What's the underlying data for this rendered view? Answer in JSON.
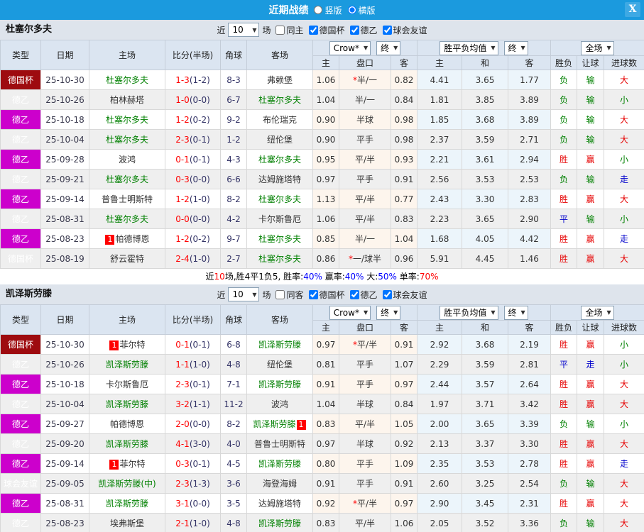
{
  "titlebar": {
    "title": "近期战绩",
    "radio_options": [
      {
        "label": "竖版",
        "selected": false
      },
      {
        "label": "横版",
        "selected": true
      }
    ],
    "close_label": "X"
  },
  "columns": {
    "type": "类型",
    "date": "日期",
    "home": "主场",
    "score": "比分(半场)",
    "corner": "角球",
    "away": "客场",
    "odds_home": "主",
    "handicap": "盘口",
    "odds_away": "客",
    "avg_home": "主",
    "avg_draw": "和",
    "avg_away": "客",
    "wdl": "胜负",
    "ah_result": "让球",
    "goals": "进球数",
    "dd_crow": "Crow*",
    "dd_final1": "终",
    "dd_avg": "胜平负均值",
    "dd_final2": "终",
    "dd_full": "全场"
  },
  "row_columns": [
    "type",
    "date",
    "home",
    "score_ft_ht",
    "corners",
    "away",
    "crow_home",
    "crow_handicap",
    "crow_away",
    "avg_home",
    "avg_draw",
    "avg_away",
    "result_wdl",
    "result_handicap",
    "result_goals"
  ],
  "colors": {
    "titlebar": "#1b9ade",
    "cup_bg": "#9e0b0f",
    "league_bg": "#cc00cc",
    "friendly_bg": "#00b3ad",
    "focal_team": "#008000",
    "win_red": "#e60000",
    "loss_green": "#008000",
    "draw_blue": "#0000cc",
    "score_red": "#ff0000",
    "half_corner_navy": "#333366",
    "odds_bg": "#fdf5ed",
    "avg_bg": "#ecf5fb",
    "stripe": "#efefef",
    "header_bg": "#dbe5f1"
  },
  "teams": [
    {
      "name": "杜塞尔多夫",
      "filter": {
        "near": "近",
        "count": "10",
        "unit": "场",
        "same_label": "同主",
        "same_checked": false,
        "leagues": [
          {
            "label": "德国杯",
            "checked": true
          },
          {
            "label": "德乙",
            "checked": true
          },
          {
            "label": "球会友谊",
            "checked": true
          }
        ]
      },
      "rows": [
        [
          "德国杯",
          "25-10-30",
          "杜塞尔多夫",
          "1-3(1-2)",
          "8-3",
          "弗赖堡",
          "1.06",
          "*半/一",
          "0.82",
          "4.41",
          "3.65",
          "1.77",
          "负",
          "输",
          "大"
        ],
        [
          "德乙",
          "25-10-26",
          "柏林赫塔",
          "1-0(0-0)",
          "6-7",
          "杜塞尔多夫",
          "1.04",
          "半/一",
          "0.84",
          "1.81",
          "3.85",
          "3.89",
          "负",
          "输",
          "小"
        ],
        [
          "德乙",
          "25-10-18",
          "杜塞尔多夫",
          "1-2(0-2)",
          "9-2",
          "布伦瑞克",
          "0.90",
          "半球",
          "0.98",
          "1.85",
          "3.68",
          "3.89",
          "负",
          "输",
          "大"
        ],
        [
          "德乙",
          "25-10-04",
          "杜塞尔多夫",
          "2-3(0-1)",
          "1-2",
          "纽伦堡",
          "0.90",
          "平手",
          "0.98",
          "2.37",
          "3.59",
          "2.71",
          "负",
          "输",
          "大"
        ],
        [
          "德乙",
          "25-09-28",
          "波鸿",
          "0-1(0-1)",
          "4-3",
          "杜塞尔多夫",
          "0.95",
          "平/半",
          "0.93",
          "2.21",
          "3.61",
          "2.94",
          "胜",
          "赢",
          "小"
        ],
        [
          "德乙",
          "25-09-21",
          "杜塞尔多夫",
          "0-3(0-0)",
          "6-6",
          "达姆施塔特",
          "0.97",
          "平手",
          "0.91",
          "2.56",
          "3.53",
          "2.53",
          "负",
          "输",
          "走"
        ],
        [
          "德乙",
          "25-09-14",
          "普鲁士明斯特",
          "1-2(1-0)",
          "8-2",
          "杜塞尔多夫",
          "1.13",
          "平/半",
          "0.77",
          "2.43",
          "3.30",
          "2.83",
          "胜",
          "赢",
          "大"
        ],
        [
          "德乙",
          "25-08-31",
          "杜塞尔多夫",
          "0-0(0-0)",
          "4-2",
          "卡尔斯鲁厄",
          "1.06",
          "平/半",
          "0.83",
          "2.23",
          "3.65",
          "2.90",
          "平",
          "输",
          "小"
        ],
        [
          "德乙",
          "25-08-23",
          "[1]帕德博恩",
          "1-2(0-2)",
          "9-7",
          "杜塞尔多夫",
          "0.85",
          "半/一",
          "1.04",
          "1.68",
          "4.05",
          "4.42",
          "胜",
          "赢",
          "走"
        ],
        [
          "德国杯",
          "25-08-19",
          "舒云霍特",
          "2-4(1-0)",
          "2-7",
          "杜塞尔多夫",
          "0.86",
          "*一/球半",
          "0.96",
          "5.91",
          "4.45",
          "1.46",
          "胜",
          "赢",
          "大"
        ]
      ],
      "summary": [
        [
          "近",
          "k"
        ],
        [
          "10",
          "r"
        ],
        [
          "场,胜4平1负5, 胜率:",
          "k"
        ],
        [
          "40%",
          "b"
        ],
        [
          " 赢率:",
          "k"
        ],
        [
          "40%",
          "b"
        ],
        [
          " 大:",
          "k"
        ],
        [
          "50%",
          "b"
        ],
        [
          " 单率:",
          "k"
        ],
        [
          "70%",
          "r"
        ]
      ]
    },
    {
      "name": "凯泽斯劳滕",
      "filter": {
        "near": "近",
        "count": "10",
        "unit": "场",
        "same_label": "同客",
        "same_checked": false,
        "leagues": [
          {
            "label": "德国杯",
            "checked": true
          },
          {
            "label": "德乙",
            "checked": true
          },
          {
            "label": "球会友谊",
            "checked": true
          }
        ]
      },
      "rows": [
        [
          "德国杯",
          "25-10-30",
          "[1]菲尔特",
          "0-1(0-1)",
          "6-8",
          "凯泽斯劳滕",
          "0.97",
          "*平/半",
          "0.91",
          "2.92",
          "3.68",
          "2.19",
          "胜",
          "赢",
          "小"
        ],
        [
          "德乙",
          "25-10-26",
          "凯泽斯劳滕",
          "1-1(1-0)",
          "4-8",
          "纽伦堡",
          "0.81",
          "平手",
          "1.07",
          "2.29",
          "3.59",
          "2.81",
          "平",
          "走",
          "小"
        ],
        [
          "德乙",
          "25-10-18",
          "卡尔斯鲁厄",
          "2-3(0-1)",
          "7-1",
          "凯泽斯劳滕",
          "0.91",
          "平手",
          "0.97",
          "2.44",
          "3.57",
          "2.64",
          "胜",
          "赢",
          "大"
        ],
        [
          "德乙",
          "25-10-04",
          "凯泽斯劳滕",
          "3-2(1-1)",
          "11-2",
          "波鸿",
          "1.04",
          "半球",
          "0.84",
          "1.97",
          "3.71",
          "3.42",
          "胜",
          "赢",
          "大"
        ],
        [
          "德乙",
          "25-09-27",
          "帕德博恩",
          "2-0(0-0)",
          "8-2",
          "凯泽斯劳滕[1]",
          "0.83",
          "平/半",
          "1.05",
          "2.00",
          "3.65",
          "3.39",
          "负",
          "输",
          "小"
        ],
        [
          "德乙",
          "25-09-20",
          "凯泽斯劳滕",
          "4-1(3-0)",
          "4-0",
          "普鲁士明斯特",
          "0.97",
          "半球",
          "0.92",
          "2.13",
          "3.37",
          "3.30",
          "胜",
          "赢",
          "大"
        ],
        [
          "德乙",
          "25-09-14",
          "[1]菲尔特",
          "0-3(0-1)",
          "4-5",
          "凯泽斯劳滕",
          "0.80",
          "平手",
          "1.09",
          "2.35",
          "3.53",
          "2.78",
          "胜",
          "赢",
          "走"
        ],
        [
          "球会友谊",
          "25-09-05",
          "凯泽斯劳滕(中)",
          "2-3(1-3)",
          "3-6",
          "海登海姆",
          "0.91",
          "平手",
          "0.91",
          "2.60",
          "3.25",
          "2.54",
          "负",
          "输",
          "大"
        ],
        [
          "德乙",
          "25-08-31",
          "凯泽斯劳滕",
          "3-1(0-0)",
          "3-5",
          "达姆施塔特",
          "0.92",
          "*平/半",
          "0.97",
          "2.90",
          "3.45",
          "2.31",
          "胜",
          "赢",
          "大"
        ],
        [
          "德乙",
          "25-08-23",
          "埃弗斯堡",
          "2-1(1-0)",
          "4-8",
          "凯泽斯劳滕",
          "0.83",
          "平/半",
          "1.06",
          "2.05",
          "3.52",
          "3.36",
          "负",
          "输",
          "大"
        ]
      ],
      "summary": null
    }
  ]
}
